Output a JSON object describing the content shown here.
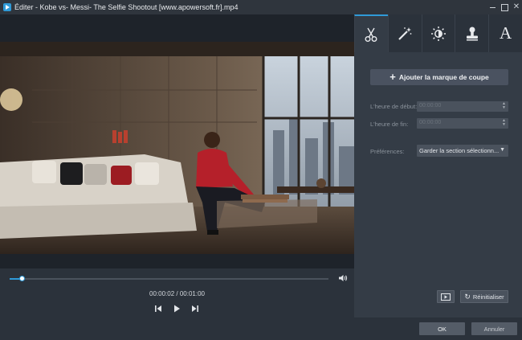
{
  "window": {
    "title": "Éditer - Kobe vs- Messi- The Selfie Shootout [www.apowersoft.fr].mp4"
  },
  "player": {
    "time": "00:00:02 / 00:01:00",
    "progress": 0.04
  },
  "tabs": [
    {
      "icon": "scissors-icon",
      "active": true
    },
    {
      "icon": "magic-wand-icon",
      "active": false
    },
    {
      "icon": "brightness-icon",
      "active": false
    },
    {
      "icon": "stamp-icon",
      "active": false
    },
    {
      "icon": "text-icon",
      "label": "A",
      "active": false
    }
  ],
  "trim": {
    "add_mark_label": "Ajouter la marque de coupe",
    "start_label": "L'heure de début:",
    "start_value": "00:00:00",
    "end_label": "L'heure de fin:",
    "end_value": "00:00:00",
    "pref_label": "Préférences:",
    "pref_value": "Garder la section sélectionn...",
    "reset_label": "Réinitialiser"
  },
  "footer": {
    "ok_label": "OK",
    "cancel_label": "Annuler"
  },
  "colors": {
    "accent": "#2f9ad8",
    "panel": "#343c46"
  }
}
